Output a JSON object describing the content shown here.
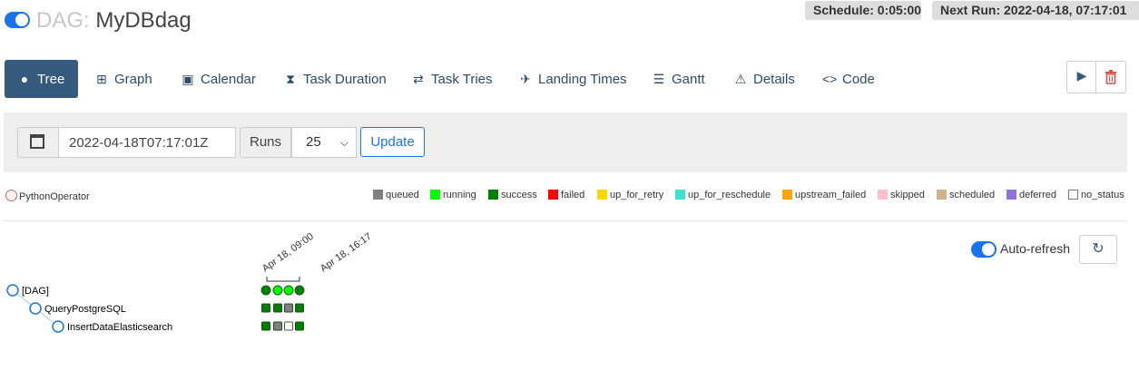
{
  "header": {
    "title_prefix": "DAG:",
    "dag_name": "MyDBdag",
    "schedule": "Schedule: 0:05:00",
    "next_run": "Next Run: 2022-04-18, 07:17:01"
  },
  "nav": {
    "tabs": [
      {
        "label": "Tree",
        "icon": "tree-icon",
        "active": true
      },
      {
        "label": "Graph",
        "icon": "graph-icon"
      },
      {
        "label": "Calendar",
        "icon": "calendar-icon"
      },
      {
        "label": "Task Duration",
        "icon": "hourglass-icon"
      },
      {
        "label": "Task Tries",
        "icon": "retry-icon"
      },
      {
        "label": "Landing Times",
        "icon": "landing-icon"
      },
      {
        "label": "Gantt",
        "icon": "gantt-icon"
      },
      {
        "label": "Details",
        "icon": "warning-icon"
      },
      {
        "label": "Code",
        "icon": "code-icon"
      }
    ],
    "trigger_icon": "play-icon",
    "delete_icon": "trash-icon"
  },
  "filters": {
    "base_date": "2022-04-18T07:17:01Z",
    "runs_label": "Runs",
    "runs_value": "25",
    "update_label": "Update"
  },
  "legend": {
    "operator": "PythonOperator",
    "states": [
      {
        "label": "queued",
        "color": "#808080"
      },
      {
        "label": "running",
        "color": "#00ff00"
      },
      {
        "label": "success",
        "color": "#008000"
      },
      {
        "label": "failed",
        "color": "#ff0000"
      },
      {
        "label": "up_for_retry",
        "color": "#ffd700"
      },
      {
        "label": "up_for_reschedule",
        "color": "#40e0d0"
      },
      {
        "label": "upstream_failed",
        "color": "#ffa500"
      },
      {
        "label": "skipped",
        "color": "#ffc0cb"
      },
      {
        "label": "scheduled",
        "color": "#d2b48c"
      },
      {
        "label": "deferred",
        "color": "#9370db"
      },
      {
        "label": "no_status",
        "color": "#ffffff"
      }
    ]
  },
  "auto_refresh": {
    "label": "Auto-refresh",
    "enabled": true,
    "refresh_icon": "refresh-icon"
  },
  "tree": {
    "run_dates": [
      "Apr 18, 09:00",
      "Apr 18, 16:17"
    ],
    "nodes": [
      "[DAG]",
      "QueryPostgreSQL",
      "InsertDataElasticsearch"
    ],
    "dag_runs": [
      "success",
      "running",
      "running",
      "success"
    ],
    "task_instances": [
      [
        "success",
        "success",
        "queued",
        "success"
      ],
      [
        "success",
        "queued",
        "no_status",
        "success"
      ]
    ]
  }
}
